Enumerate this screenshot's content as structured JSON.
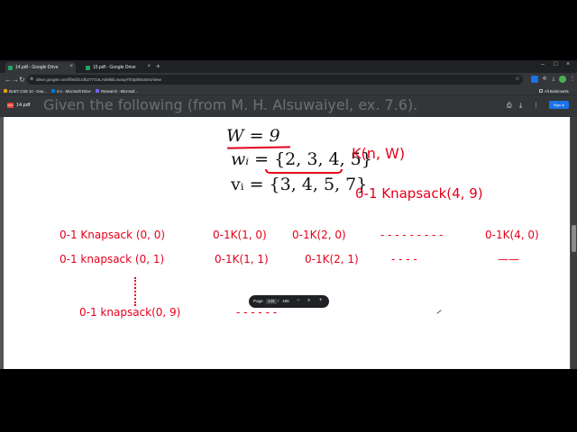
{
  "tabs": [
    {
      "title": "14.pdf - Google Drive",
      "active": true
    },
    {
      "title": "15.pdf - Google Drive",
      "active": false
    }
  ],
  "address": {
    "url": "drive.google.com/file/d/1rdh277G4LAkMkiiLnwxqYh0q5h5o0mr/view"
  },
  "bookmarks": {
    "items": [
      "BUET CSE 10 - Goo...",
      "4-1 - Microsoft Drive",
      "Research - Microsof..."
    ],
    "all_bookmarks": "All Bookmarks"
  },
  "pdf": {
    "file_name": "14.pdf",
    "heading_cut": "Given the following (from M. H. Alsuwaiyel, ex. 7.6).",
    "sign_in": "Sign in"
  },
  "slide": {
    "W_line": "W = 9",
    "w_line_left": "wᵢ = ",
    "w_set": "{2, 3, 4, 5}",
    "v_line": "vᵢ = {3, 4, 5, 7}",
    "annot_k": "K(n, W)",
    "annot_knap": "0-1 Knapsack(4, 9)",
    "row1": {
      "a": "0-1 Knapsack (0, 0)",
      "b": "0-1K(1, 0)",
      "c": "0-1K(2, 0)",
      "dash": "- - - - - - - - -",
      "d": "0-1K(4, 0)"
    },
    "row2": {
      "a": "0-1 knapsack (0, 1)",
      "b": "0-1K(1, 1)",
      "c": "0-1K(2, 1)",
      "dash": "-   -   -   -",
      "d": "——"
    },
    "row3": {
      "a": "0-1 knapsack(0, 9)",
      "dash": "-   -   -   -   -   -"
    }
  },
  "zoom": {
    "label": "Page",
    "current": "145",
    "sep": "/",
    "total": "196",
    "minus": "−",
    "plus": "+"
  },
  "colors": {
    "ink_red": "#e4001b",
    "chrome_dark": "#202124",
    "viewer_bg": "#525659"
  }
}
